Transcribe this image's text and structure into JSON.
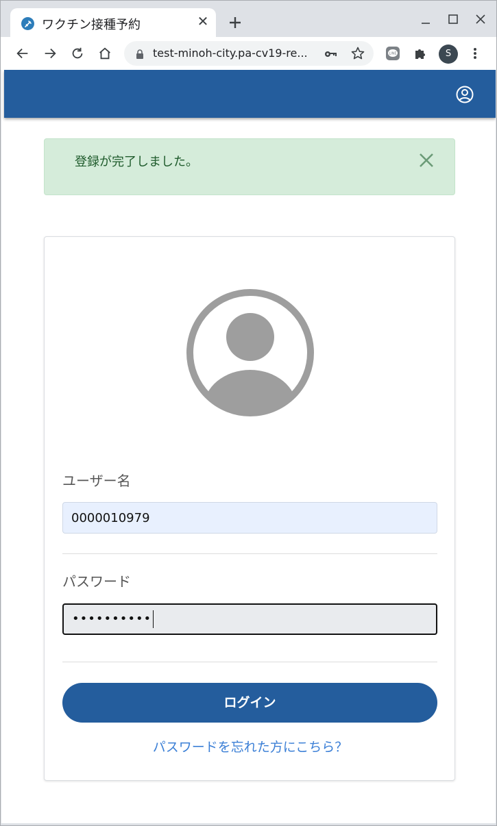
{
  "browser": {
    "tab": {
      "title": "ワクチン接種予約",
      "favicon": "syringe-icon"
    },
    "url": "test-minoh-city.pa-cv19-re...",
    "profile_initial": "S"
  },
  "colors": {
    "header": "#245d9d",
    "alert_bg": "#d5ecda",
    "alert_text": "#1f5b2c",
    "link": "#3b7fd6"
  },
  "alert": {
    "message": "登録が完了しました。"
  },
  "login": {
    "username_label": "ユーザー名",
    "username_value": "0000010979",
    "password_label": "パスワード",
    "password_value": "••••••••••",
    "submit_label": "ログイン",
    "forgot_link": "パスワードを忘れた方にこちら？"
  }
}
